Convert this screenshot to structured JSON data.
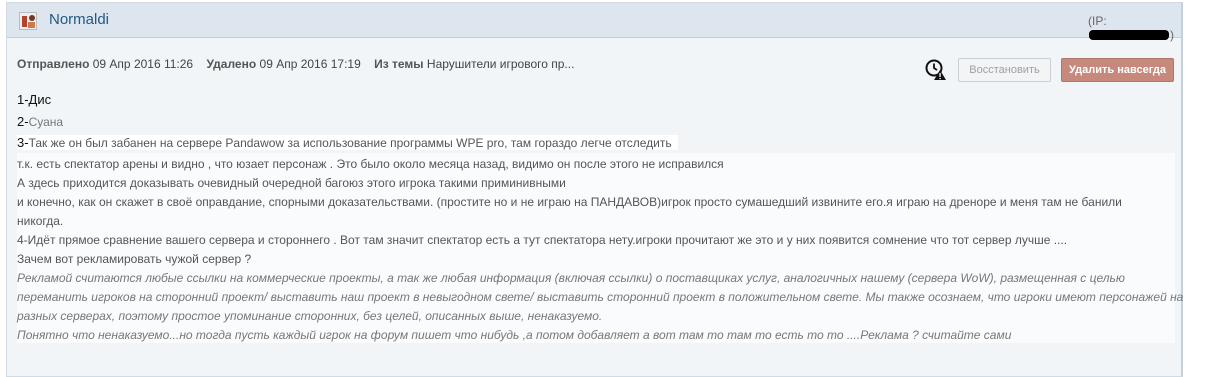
{
  "header": {
    "username": "Normaldi",
    "ip_prefix": "(IP:",
    "ip_suffix": ")"
  },
  "meta": {
    "sent_label": "Отправлено",
    "sent_date": "09 Апр 2016 11:26",
    "deleted_label": "Удалено",
    "deleted_date": "09 Апр 2016 17:19",
    "topic_label": "Из темы",
    "topic_name": "Нарушители игрового пр..."
  },
  "actions": {
    "restore": "Восстановить",
    "delete_forever": "Удалить навсегда"
  },
  "post": {
    "line1": "1-Дис",
    "line2_num": "2-",
    "line2_text": "Суана",
    "line3_num": "3-",
    "line3_text": "Так же он был забанен на сервере Pandawow за использование программы WPE pro, там гораздо легче отследить",
    "p1": "т.к. есть спектатор арены и видно , что юзает персонаж . Это было около месяца назад, видимо он после этого не исправился",
    "p2": "А здесь приходится доказывать очевидный очередной багоюз этого игрока такими приминивными",
    "p3": "и конечно, как он скажет в своё оправдание, спорными доказательствами. (простите но и не играю на ПАНДАВОВ)игрок просто сумашедший извините его.я играю на дреноре и меня там не банили",
    "p4": "никогда.",
    "p5": "4-Идёт прямое сравнение вашего сервера и стороннего . Вот там значит спектатор есть а тут спектатора нету.игроки прочитают же это и у них появится сомнение что тот сервер лучше ....",
    "p6": "Зачем вот рекламировать чужой сервер ?",
    "q1": "Рекламой считаются любые ссылки на коммерческие проекты, а так же любая информация (включая ссылки) о поставщиках услуг, аналогичных нашему (сервера WoW), размещенная с целью",
    "q2": "переманить игроков на сторонний проект/ выставить наш проект в невыгодном свете/ выставить сторонний проект в положительном свете. Мы также осознаем, что игроки имеют персонажей на",
    "q3": "разных серверах, поэтому простое упоминание сторонних, без целей, описанных выше, ненаказуемо.",
    "q4": "Понятно что ненаказуемо...но тогда пусть каждый игрок на форум пишет что нибудь ,а потом добавляет а вот там то там то есть то то ....Реклама ? считайте сами"
  }
}
